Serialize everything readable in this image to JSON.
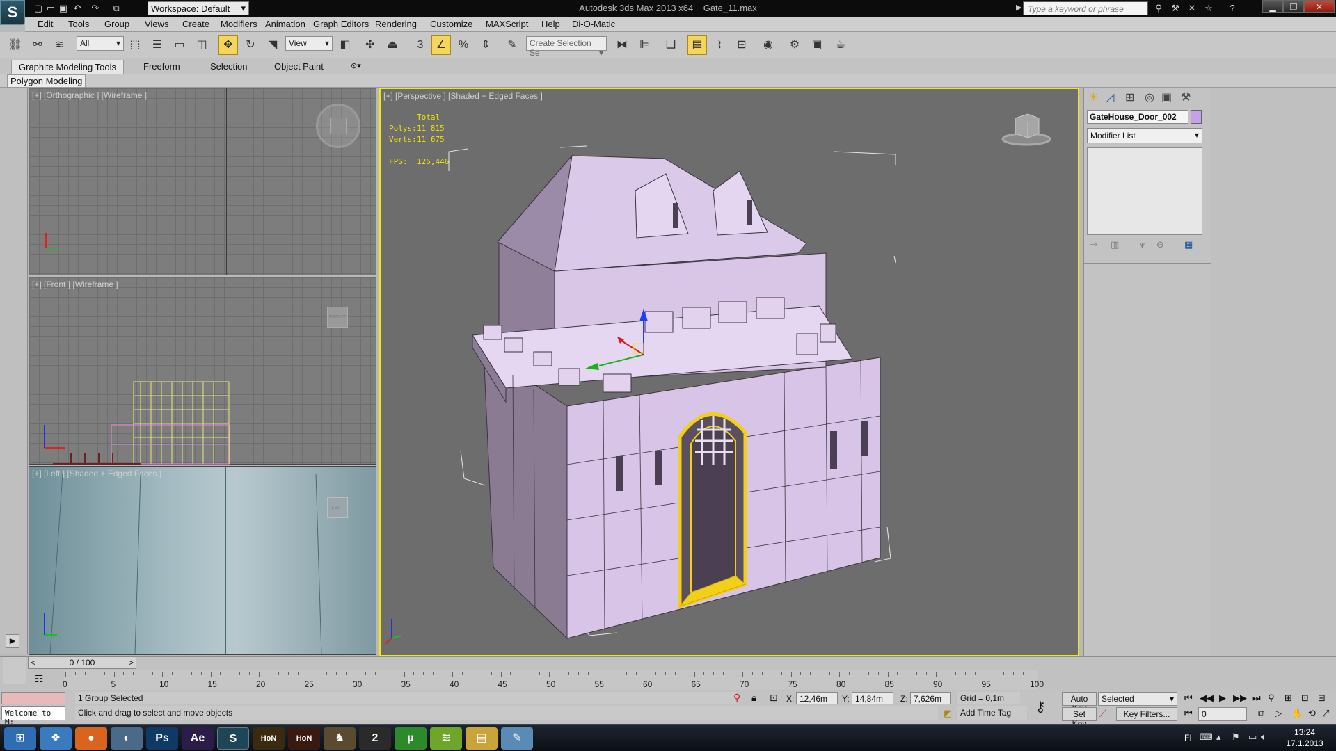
{
  "app": {
    "title": "Autodesk 3ds Max  2013 x64",
    "file": "Gate_11.max",
    "workspace": "Workspace: Default",
    "search_placeholder": "Type a keyword or phrase"
  },
  "menu": [
    "Edit",
    "Tools",
    "Group",
    "Views",
    "Create",
    "Modifiers",
    "Animation",
    "Graph Editors",
    "Rendering",
    "Customize",
    "MAXScript",
    "Help",
    "Di-O-Matic"
  ],
  "toolbar": {
    "selection_filter": "All",
    "ref_coord": "View",
    "named_selection": "Create Selection Se"
  },
  "ribbon": {
    "tabs": [
      "Graphite Modeling Tools",
      "Freeform",
      "Selection",
      "Object Paint"
    ],
    "panel_label": "Polygon Modeling"
  },
  "viewports": {
    "top_left": "[+] [Orthographic ] [Wireframe ]",
    "front": "[+] [Front ] [Wireframe ]",
    "left": "[+] [Left ] [Shaded + Edged Faces ]",
    "perspective": "[+] [Perspective ] [Shaded + Edged Faces ]",
    "front_cube": "FRONT",
    "left_cube": "LEFT"
  },
  "stats": {
    "header": "Total",
    "polys_label": "Polys:",
    "polys": "11 815",
    "verts_label": "Verts:",
    "verts": "11 675",
    "fps_label": "FPS:",
    "fps": "126,446"
  },
  "command_panel": {
    "object_name": "GateHouse_Door_002",
    "modifier_list": "Modifier List",
    "object_color": "#c6a1ea"
  },
  "timeline": {
    "frame": "0 / 100",
    "ticks": [
      "0",
      "5",
      "10",
      "15",
      "20",
      "25",
      "30",
      "35",
      "40",
      "45",
      "50",
      "55",
      "60",
      "65",
      "70",
      "75",
      "80",
      "85",
      "90",
      "95",
      "100"
    ]
  },
  "status": {
    "maxscript": "Welcome to M:",
    "selection": "1 Group Selected",
    "prompt": "Click and drag to select and move objects",
    "x_label": "X:",
    "x": "12,46m",
    "y_label": "Y:",
    "y": "14,84m",
    "z_label": "Z:",
    "z": "7,626m",
    "grid": "Grid = 0,1m",
    "add_time_tag": "Add Time Tag",
    "auto_key": "Auto Key",
    "set_key": "Set Key",
    "key_mode": "Selected",
    "key_filters": "Key Filters...",
    "current_frame": "0"
  },
  "taskbar": {
    "icons": [
      {
        "name": "windows-start-icon",
        "glyph": "⊞",
        "color": "#2f6db3"
      },
      {
        "name": "windows-logo-icon",
        "glyph": "❖",
        "color": "#3a7abf"
      },
      {
        "name": "firefox-icon",
        "glyph": "●",
        "color": "#d8641e"
      },
      {
        "name": "media-player-icon",
        "glyph": "◐",
        "color": "#4a6a8a"
      },
      {
        "name": "photoshop-icon",
        "glyph": "Ps",
        "color": "#0f3a66"
      },
      {
        "name": "after-effects-icon",
        "glyph": "Ae",
        "color": "#2b1d4a"
      },
      {
        "name": "3dsmax-taskbar-icon",
        "glyph": "S",
        "color": "#1e4656"
      },
      {
        "name": "hon-icon",
        "glyph": "HoN",
        "color": "#3a2a10"
      },
      {
        "name": "hon-test-icon",
        "glyph": "HoN",
        "color": "#3a1a10"
      },
      {
        "name": "game-character-icon",
        "glyph": "♞",
        "color": "#5a4a30"
      },
      {
        "name": "gw2-icon",
        "glyph": "2",
        "color": "#2a2a2a"
      },
      {
        "name": "utorrent-icon",
        "glyph": "µ",
        "color": "#2d8a2a"
      },
      {
        "name": "spotify-icon",
        "glyph": "≋",
        "color": "#6ea62a"
      },
      {
        "name": "explorer-folder-icon",
        "glyph": "▤",
        "color": "#c9a43b"
      },
      {
        "name": "notepad-icon",
        "glyph": "✎",
        "color": "#5a8ab6"
      }
    ],
    "language": "FI",
    "time": "13:24",
    "date": "17.1.2013"
  }
}
